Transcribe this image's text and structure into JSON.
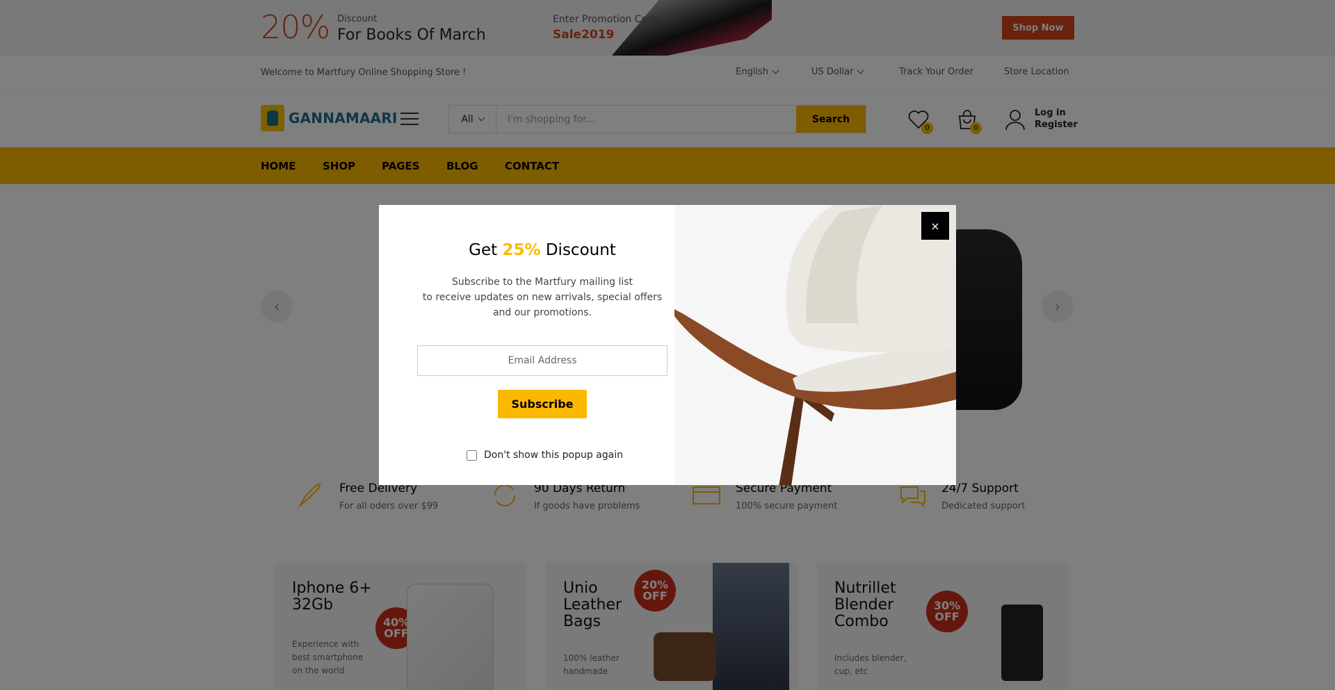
{
  "promo": {
    "percent": "20%",
    "small": "Discount",
    "big": "For Books Of March",
    "code_label": "Enter Promotion Code",
    "code": "Sale2019",
    "shop_now": "Shop Now"
  },
  "toplinks": {
    "welcome": "Welcome to Martfury Online Shopping Store !",
    "language": "English",
    "currency": "US Dollar",
    "track": "Track Your Order",
    "store": "Store Location"
  },
  "header": {
    "logo_text": "GANNAMAARI",
    "category": "All",
    "search_placeholder": "I'm shopping for...",
    "search_button": "Search",
    "wishlist_count": "0",
    "cart_count": "0",
    "login": "Log in",
    "register": "Register"
  },
  "nav": [
    "HOME",
    "SHOP",
    "PAGES",
    "BLOG",
    "CONTACT"
  ],
  "features": [
    {
      "title": "Free Delivery",
      "desc": "For all oders over $99"
    },
    {
      "title": "90 Days Return",
      "desc": "If goods have problems"
    },
    {
      "title": "Secure Payment",
      "desc": "100% secure payment"
    },
    {
      "title": "24/7 Support",
      "desc": "Dedicated support"
    }
  ],
  "promo_cards": [
    {
      "title": "Iphone 6+ 32Gb",
      "badge_top": "40%",
      "badge_bottom": "OFF",
      "desc": "Experience with best smartphone on the world"
    },
    {
      "title": "Unio Leather Bags",
      "badge_top": "20%",
      "badge_bottom": "OFF",
      "desc": "100% leather handmade"
    },
    {
      "title": "Nutrillet Blender Combo",
      "badge_top": "30%",
      "badge_bottom": "OFF",
      "desc": "Includes blender, cup, etc"
    }
  ],
  "modal": {
    "heading_pre": "Get ",
    "heading_accent": "25%",
    "heading_post": " Discount",
    "text_line1": "Subscribe to the Martfury mailing list",
    "text_line2": "to receive updates on new arrivals, special offers",
    "text_line3": "and our promotions.",
    "email_placeholder": "Email Address",
    "subscribe": "Subscribe",
    "dont_show": "Don't show this popup again",
    "close": "×"
  },
  "colors": {
    "accent": "#fcb800",
    "promo_red": "#d4451c",
    "badge_red": "#c9301a"
  }
}
